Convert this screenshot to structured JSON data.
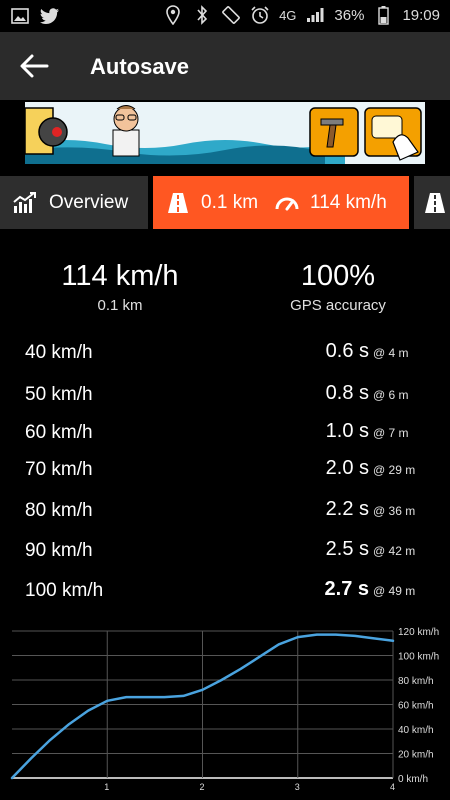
{
  "status_bar": {
    "network": "4G",
    "battery": "36%",
    "time": "19:09"
  },
  "app_bar": {
    "title": "Autosave"
  },
  "tabs": {
    "overview_label": "Overview",
    "run_distance": "0.1 km",
    "run_speed": "114 km/h"
  },
  "summary": {
    "top_speed": "114 km/h",
    "distance": "0.1 km",
    "gps_accuracy_value": "100%",
    "gps_accuracy_label": "GPS accuracy"
  },
  "acceleration": [
    {
      "speed": "40 km/h",
      "time": "0.6 s",
      "distance": "@ 4 m"
    },
    {
      "speed": "50 km/h",
      "time": "0.8 s",
      "distance": "@ 6 m"
    },
    {
      "speed": "60 km/h",
      "time": "1.0 s",
      "distance": "@ 7 m"
    },
    {
      "speed": "70 km/h",
      "time": "2.0 s",
      "distance": "@ 29 m"
    },
    {
      "speed": "80 km/h",
      "time": "2.2 s",
      "distance": "@ 36 m"
    },
    {
      "speed": "90 km/h",
      "time": "2.5 s",
      "distance": "@ 42 m"
    },
    {
      "speed": "100 km/h",
      "time": "2.7 s",
      "distance": "@ 49 m"
    }
  ],
  "chart_data": {
    "type": "line",
    "xlabel": "",
    "ylabel": "",
    "xlim": [
      0,
      4
    ],
    "ylim": [
      0,
      120
    ],
    "x_ticks": [
      "1",
      "2",
      "3",
      "4"
    ],
    "y_ticks": [
      "0 km/h",
      "20 km/h",
      "40 km/h",
      "60 km/h",
      "80 km/h",
      "100 km/h",
      "120 km/h"
    ],
    "series": [
      {
        "color": "#4aa3df",
        "x": [
          0,
          0.2,
          0.4,
          0.6,
          0.8,
          1.0,
          1.2,
          1.4,
          1.6,
          1.8,
          2.0,
          2.2,
          2.4,
          2.6,
          2.8,
          3.0,
          3.2,
          3.4,
          3.6,
          3.8,
          4.0
        ],
        "y": [
          0,
          16,
          31,
          44,
          55,
          63,
          66,
          66,
          66,
          67,
          72,
          80,
          89,
          99,
          109,
          115,
          117,
          117,
          116,
          114,
          112
        ]
      }
    ],
    "grid": true,
    "legend": "none"
  }
}
